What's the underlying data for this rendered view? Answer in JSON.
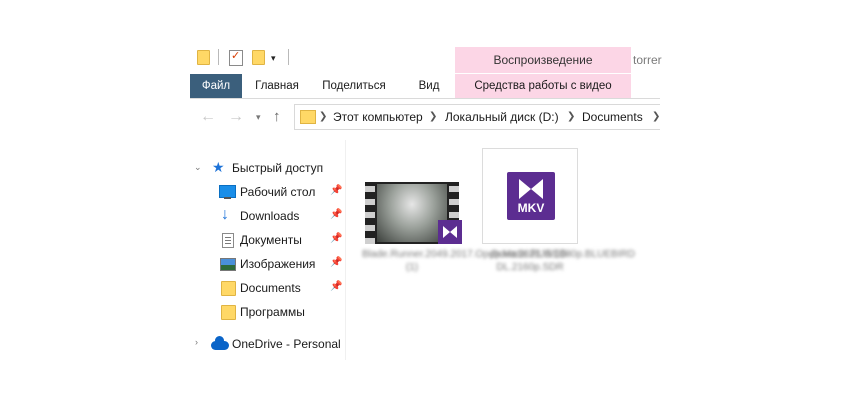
{
  "window": {
    "title_fragment": "torrer"
  },
  "ribbon": {
    "context_header": "Воспроизведение",
    "tabs": [
      {
        "label": "Файл"
      },
      {
        "label": "Главная"
      },
      {
        "label": "Поделиться"
      },
      {
        "label": "Вид"
      },
      {
        "label": "Средства работы с видео"
      }
    ]
  },
  "address": {
    "crumbs": [
      "Этот компьютер",
      "Локальный диск (D:)",
      "Documents"
    ]
  },
  "sidebar": {
    "quick_access": "Быстрый доступ",
    "items": [
      {
        "label": "Рабочий стол",
        "icon": "desktop-icon",
        "pinned": true
      },
      {
        "label": "Downloads",
        "icon": "download-arrow-icon",
        "pinned": true
      },
      {
        "label": "Документы",
        "icon": "document-icon",
        "pinned": true
      },
      {
        "label": "Изображения",
        "icon": "picture-icon",
        "pinned": true
      },
      {
        "label": "Documents",
        "icon": "folder-icon",
        "pinned": true
      },
      {
        "label": "Программы",
        "icon": "folder-icon",
        "pinned": false
      }
    ],
    "onedrive": "OneDrive - Personal"
  },
  "files": [
    {
      "name": "Blade.Runner.2049.2017.Open.Matte.RUS.1080p.BLUEBIRD (1)",
      "type": "video-thumbnail"
    },
    {
      "name": "Дюна.2021.WEB-DL.2160p.SDR",
      "badge": "MKV",
      "type": "mkv-file"
    }
  ],
  "colors": {
    "file_tab": "#3b5f7c",
    "context_tab": "#fcd6e6",
    "media_badge": "#5c2d91",
    "folder": "#ffd866"
  }
}
